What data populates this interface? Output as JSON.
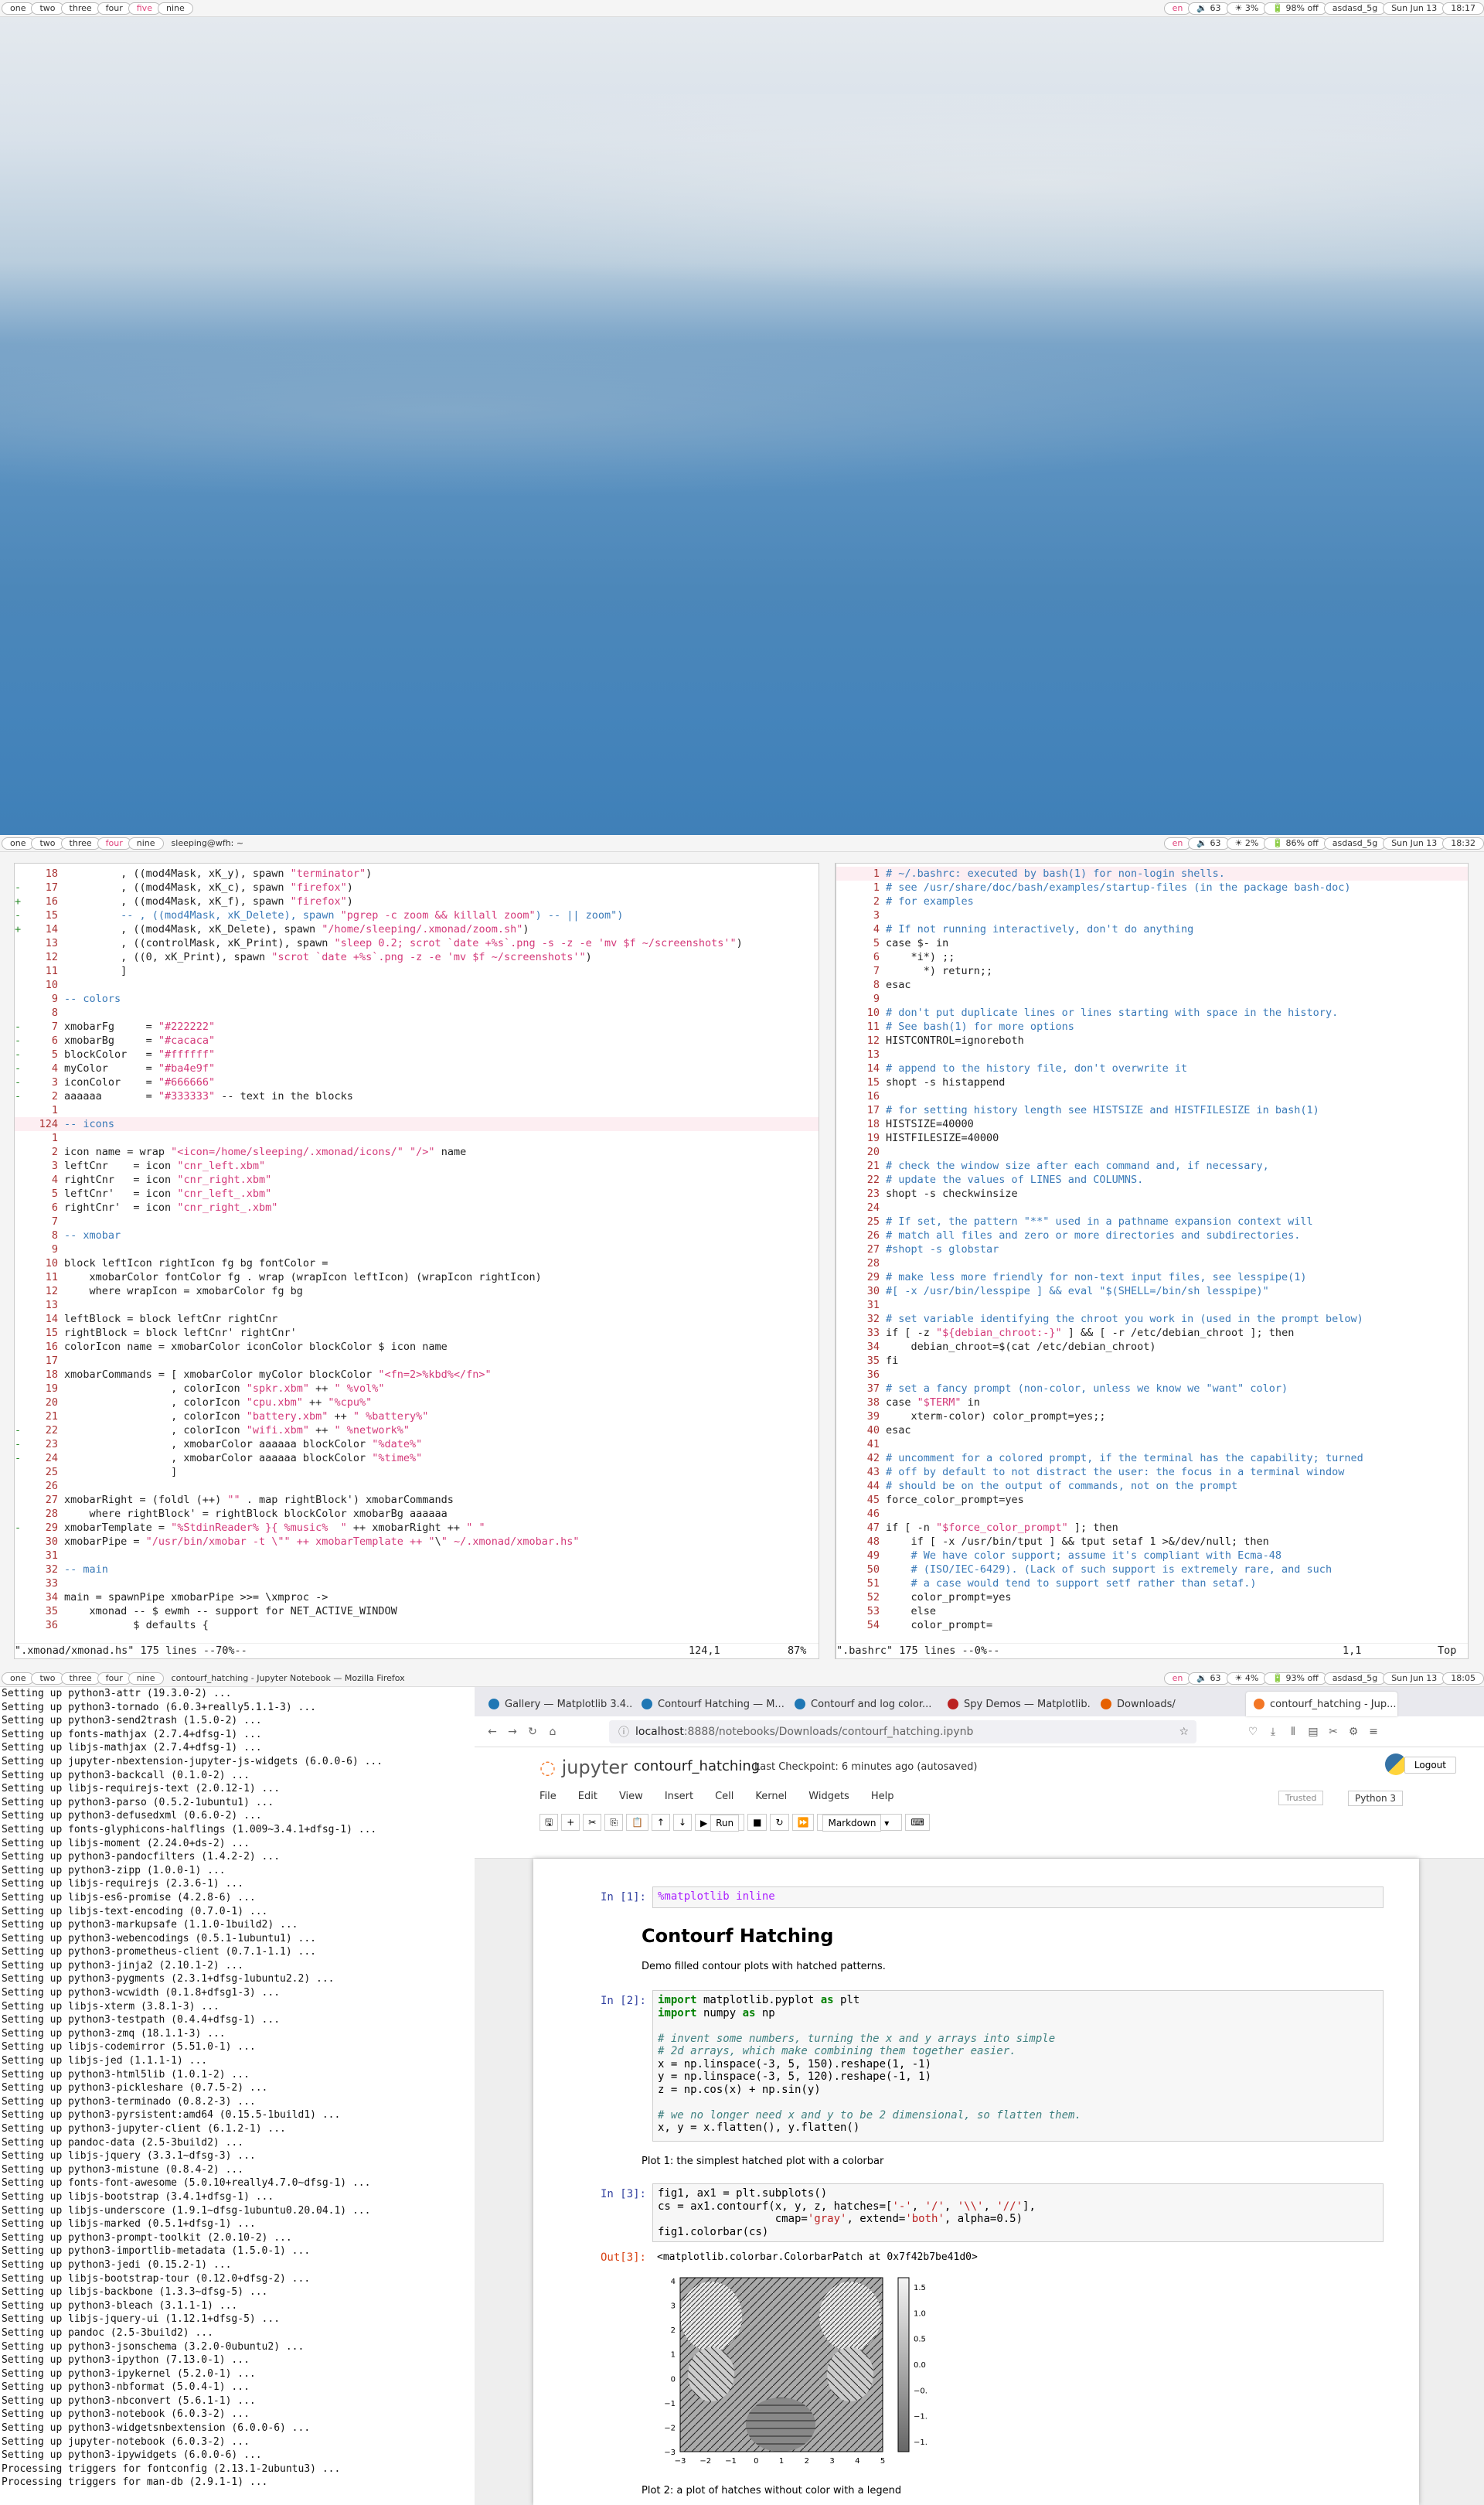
{
  "screen1": {
    "workspaces": [
      "one",
      "two",
      "three",
      "four",
      "five",
      "nine"
    ],
    "active": "five",
    "status": {
      "lang": "en",
      "volume": "🔉 63",
      "brightness": "☀ 3%",
      "battery": "🔋 98% off",
      "wifi": "asdasd_5g",
      "date": "Sun Jun 13",
      "time": "18:17"
    }
  },
  "screen2": {
    "workspaces": [
      "one",
      "two",
      "three",
      "four",
      "nine"
    ],
    "active": "four",
    "title": "sleeping@wfh: ~",
    "status": {
      "lang": "en",
      "volume": "🔉 63",
      "brightness": "☀ 2%",
      "battery": "🔋 86% off",
      "wifi": "asdasd_5g",
      "date": "Sun Jun 13",
      "time": "18:32"
    },
    "left_vim": {
      "lines": [
        [
          "",
          "18",
          "         , ((mod4Mask, xK_y), spawn \"terminator\")"
        ],
        [
          "-",
          "17",
          "         , ((mod4Mask, xK_c), spawn \"firefox\")"
        ],
        [
          "+",
          "16",
          "         , ((mod4Mask, xK_f), spawn \"firefox\")"
        ],
        [
          "-",
          "15",
          "         -- , ((mod4Mask, xK_Delete), spawn \"pgrep -c zoom && killall zoom\") -- || zoom\")"
        ],
        [
          "+",
          "14",
          "         , ((mod4Mask, xK_Delete), spawn \"/home/sleeping/.xmonad/zoom.sh\")"
        ],
        [
          "",
          "13",
          "         , ((controlMask, xK_Print), spawn \"sleep 0.2; scrot `date +%s`.png -s -z -e 'mv $f ~/screenshots'\")"
        ],
        [
          "",
          "12",
          "         , ((0, xK_Print), spawn \"scrot `date +%s`.png -z -e 'mv $f ~/screenshots'\")"
        ],
        [
          "",
          "11",
          "         ]"
        ],
        [
          "",
          "10",
          ""
        ],
        [
          "",
          "9",
          "-- colors"
        ],
        [
          "",
          "8",
          ""
        ],
        [
          "-",
          "7",
          "xmobarFg     = \"#222222\""
        ],
        [
          "-",
          "6",
          "xmobarBg     = \"#cacaca\""
        ],
        [
          "-",
          "5",
          "blockColor   = \"#ffffff\""
        ],
        [
          "-",
          "4",
          "myColor      = \"#ba4e9f\""
        ],
        [
          "-",
          "3",
          "iconColor    = \"#666666\""
        ],
        [
          "-",
          "2",
          "aaaaaa       = \"#333333\" -- text in the blocks"
        ],
        [
          "",
          "1",
          ""
        ],
        [
          "",
          "124",
          "-- icons"
        ],
        [
          "",
          "1",
          ""
        ],
        [
          "",
          "2",
          "icon name = wrap \"<icon=/home/sleeping/.xmonad/icons/\" \"/>\" name"
        ],
        [
          "",
          "3",
          "leftCnr    = icon \"cnr_left.xbm\""
        ],
        [
          "",
          "4",
          "rightCnr   = icon \"cnr_right.xbm\""
        ],
        [
          "",
          "5",
          "leftCnr'   = icon \"cnr_left_.xbm\""
        ],
        [
          "",
          "6",
          "rightCnr'  = icon \"cnr_right_.xbm\""
        ],
        [
          "",
          "7",
          ""
        ],
        [
          "",
          "8",
          "-- xmobar"
        ],
        [
          "",
          "9",
          ""
        ],
        [
          "",
          "10",
          "block leftIcon rightIcon fg bg fontColor ="
        ],
        [
          "",
          "11",
          "    xmobarColor fontColor fg . wrap (wrapIcon leftIcon) (wrapIcon rightIcon)"
        ],
        [
          "",
          "12",
          "    where wrapIcon = xmobarColor fg bg"
        ],
        [
          "",
          "13",
          ""
        ],
        [
          "",
          "14",
          "leftBlock = block leftCnr rightCnr"
        ],
        [
          "",
          "15",
          "rightBlock = block leftCnr' rightCnr'"
        ],
        [
          "",
          "16",
          "colorIcon name = xmobarColor iconColor blockColor $ icon name"
        ],
        [
          "",
          "17",
          ""
        ],
        [
          "",
          "18",
          "xmobarCommands = [ xmobarColor myColor blockColor \"<fn=2>%kbd%</fn>\""
        ],
        [
          "",
          "19",
          "                 , colorIcon \"spkr.xbm\" ++ \" %vol%\""
        ],
        [
          "",
          "20",
          "                 , colorIcon \"cpu.xbm\" ++ \"%cpu%\""
        ],
        [
          "",
          "21",
          "                 , colorIcon \"battery.xbm\" ++ \" %battery%\""
        ],
        [
          "-",
          "22",
          "                 , colorIcon \"wifi.xbm\" ++ \" %network%\""
        ],
        [
          "-",
          "23",
          "                 , xmobarColor aaaaaa blockColor \"%date%\""
        ],
        [
          "-",
          "24",
          "                 , xmobarColor aaaaaa blockColor \"%time%\""
        ],
        [
          "",
          "25",
          "                 ]"
        ],
        [
          "",
          "26",
          ""
        ],
        [
          "",
          "27",
          "xmobarRight = (foldl (++) \"\" . map rightBlock') xmobarCommands"
        ],
        [
          "",
          "28",
          "    where rightBlock' = rightBlock blockColor xmobarBg aaaaaa"
        ],
        [
          "-",
          "29",
          "xmobarTemplate = \"%StdinReader% }{ %music%  \" ++ xmobarRight ++ \" \""
        ],
        [
          "",
          "30",
          "xmobarPipe = \"/usr/bin/xmobar -t \\\"\" ++ xmobarTemplate ++ \"\\\" ~/.xmonad/xmobar.hs\""
        ],
        [
          "",
          "31",
          ""
        ],
        [
          "",
          "32",
          "-- main"
        ],
        [
          "",
          "33",
          ""
        ],
        [
          "",
          "34",
          "main = spawnPipe xmobarPipe >>= \\xmproc ->"
        ],
        [
          "",
          "35",
          "    xmonad -- $ ewmh -- support for NET_ACTIVE_WINDOW"
        ],
        [
          "",
          "36",
          "           $ defaults {"
        ]
      ],
      "status": "\".xmonad/xmonad.hs\" 175 lines --70%--",
      "pos": "124,1",
      "pct": "87%"
    },
    "right_vim": {
      "lines": [
        [
          "",
          "1",
          "# ~/.bashrc: executed by bash(1) for non-login shells."
        ],
        [
          "",
          "1",
          "# see /usr/share/doc/bash/examples/startup-files (in the package bash-doc)"
        ],
        [
          "",
          "2",
          "# for examples"
        ],
        [
          "",
          "3",
          ""
        ],
        [
          "",
          "4",
          "# If not running interactively, don't do anything"
        ],
        [
          "",
          "5",
          "case $- in"
        ],
        [
          "",
          "6",
          "    *i*) ;;"
        ],
        [
          "",
          "7",
          "      *) return;;"
        ],
        [
          "",
          "8",
          "esac"
        ],
        [
          "",
          "9",
          ""
        ],
        [
          "",
          "10",
          "# don't put duplicate lines or lines starting with space in the history."
        ],
        [
          "",
          "11",
          "# See bash(1) for more options"
        ],
        [
          "",
          "12",
          "HISTCONTROL=ignoreboth"
        ],
        [
          "",
          "13",
          ""
        ],
        [
          "",
          "14",
          "# append to the history file, don't overwrite it"
        ],
        [
          "",
          "15",
          "shopt -s histappend"
        ],
        [
          "",
          "16",
          ""
        ],
        [
          "",
          "17",
          "# for setting history length see HISTSIZE and HISTFILESIZE in bash(1)"
        ],
        [
          "",
          "18",
          "HISTSIZE=40000"
        ],
        [
          "",
          "19",
          "HISTFILESIZE=40000"
        ],
        [
          "",
          "20",
          ""
        ],
        [
          "",
          "21",
          "# check the window size after each command and, if necessary,"
        ],
        [
          "",
          "22",
          "# update the values of LINES and COLUMNS."
        ],
        [
          "",
          "23",
          "shopt -s checkwinsize"
        ],
        [
          "",
          "24",
          ""
        ],
        [
          "",
          "25",
          "# If set, the pattern \"**\" used in a pathname expansion context will"
        ],
        [
          "",
          "26",
          "# match all files and zero or more directories and subdirectories."
        ],
        [
          "",
          "27",
          "#shopt -s globstar"
        ],
        [
          "",
          "28",
          ""
        ],
        [
          "",
          "29",
          "# make less more friendly for non-text input files, see lesspipe(1)"
        ],
        [
          "",
          "30",
          "#[ -x /usr/bin/lesspipe ] && eval \"$(SHELL=/bin/sh lesspipe)\""
        ],
        [
          "",
          "31",
          ""
        ],
        [
          "",
          "32",
          "# set variable identifying the chroot you work in (used in the prompt below)"
        ],
        [
          "",
          "33",
          "if [ -z \"${debian_chroot:-}\" ] && [ -r /etc/debian_chroot ]; then"
        ],
        [
          "",
          "34",
          "    debian_chroot=$(cat /etc/debian_chroot)"
        ],
        [
          "",
          "35",
          "fi"
        ],
        [
          "",
          "36",
          ""
        ],
        [
          "",
          "37",
          "# set a fancy prompt (non-color, unless we know we \"want\" color)"
        ],
        [
          "",
          "38",
          "case \"$TERM\" in"
        ],
        [
          "",
          "39",
          "    xterm-color) color_prompt=yes;;"
        ],
        [
          "",
          "40",
          "esac"
        ],
        [
          "",
          "41",
          ""
        ],
        [
          "",
          "42",
          "# uncomment for a colored prompt, if the terminal has the capability; turned"
        ],
        [
          "",
          "43",
          "# off by default to not distract the user: the focus in a terminal window"
        ],
        [
          "",
          "44",
          "# should be on the output of commands, not on the prompt"
        ],
        [
          "",
          "45",
          "force_color_prompt=yes"
        ],
        [
          "",
          "46",
          ""
        ],
        [
          "",
          "47",
          "if [ -n \"$force_color_prompt\" ]; then"
        ],
        [
          "",
          "48",
          "    if [ -x /usr/bin/tput ] && tput setaf 1 >&/dev/null; then"
        ],
        [
          "",
          "49",
          "    # We have color support; assume it's compliant with Ecma-48"
        ],
        [
          "",
          "50",
          "    # (ISO/IEC-6429). (Lack of such support is extremely rare, and such"
        ],
        [
          "",
          "51",
          "    # a case would tend to support setf rather than setaf.)"
        ],
        [
          "",
          "52",
          "    color_prompt=yes"
        ],
        [
          "",
          "53",
          "    else"
        ],
        [
          "",
          "54",
          "    color_prompt="
        ]
      ],
      "status": "\".bashrc\" 175 lines --0%--",
      "pos": "1,1",
      "pct": "Top"
    }
  },
  "screen3": {
    "workspaces": [
      "one",
      "two",
      "three",
      "four",
      "nine"
    ],
    "active": "",
    "title": "contourf_hatching - Jupyter Notebook — Mozilla Firefox",
    "status": {
      "lang": "en",
      "volume": "🔉 63",
      "brightness": "☀ 4%",
      "battery": "🔋 93% off",
      "wifi": "asdasd_5g",
      "date": "Sun Jun 13",
      "time": "18:05"
    },
    "terminal": [
      "Setting up python3-attr (19.3.0-2) ...",
      "Setting up python3-tornado (6.0.3+really5.1.1-3) ...",
      "Setting up python3-send2trash (1.5.0-2) ...",
      "Setting up fonts-mathjax (2.7.4+dfsg-1) ...",
      "Setting up libjs-mathjax (2.7.4+dfsg-1) ...",
      "Setting up jupyter-nbextension-jupyter-js-widgets (6.0.0-6) ...",
      "Setting up python3-backcall (0.1.0-2) ...",
      "Setting up libjs-requirejs-text (2.0.12-1) ...",
      "Setting up python3-parso (0.5.2-1ubuntu1) ...",
      "Setting up python3-defusedxml (0.6.0-2) ...",
      "Setting up fonts-glyphicons-halflings (1.009~3.4.1+dfsg-1) ...",
      "Setting up libjs-moment (2.24.0+ds-2) ...",
      "Setting up python3-pandocfilters (1.4.2-2) ...",
      "Setting up python3-zipp (1.0.0-1) ...",
      "Setting up libjs-requirejs (2.3.6-1) ...",
      "Setting up libjs-es6-promise (4.2.8-6) ...",
      "Setting up libjs-text-encoding (0.7.0-1) ...",
      "Setting up python3-markupsafe (1.1.0-1build2) ...",
      "Setting up python3-webencodings (0.5.1-1ubuntu1) ...",
      "Setting up python3-prometheus-client (0.7.1-1.1) ...",
      "Setting up python3-jinja2 (2.10.1-2) ...",
      "Setting up python3-pygments (2.3.1+dfsg-1ubuntu2.2) ...",
      "Setting up python3-wcwidth (0.1.8+dfsg1-3) ...",
      "Setting up libjs-xterm (3.8.1-3) ...",
      "Setting up python3-testpath (0.4.4+dfsg-1) ...",
      "Setting up python3-zmq (18.1.1-3) ...",
      "Setting up libjs-codemirror (5.51.0-1) ...",
      "Setting up libjs-jed (1.1.1-1) ...",
      "Setting up python3-html5lib (1.0.1-2) ...",
      "Setting up python3-pickleshare (0.7.5-2) ...",
      "Setting up python3-terminado (0.8.2-3) ...",
      "Setting up python3-pyrsistent:amd64 (0.15.5-1build1) ...",
      "Setting up python3-jupyter-client (6.1.2-1) ...",
      "Setting up pandoc-data (2.5-3build2) ...",
      "Setting up libjs-jquery (3.3.1~dfsg-3) ...",
      "Setting up python3-mistune (0.8.4-2) ...",
      "Setting up fonts-font-awesome (5.0.10+really4.7.0~dfsg-1) ...",
      "Setting up libjs-bootstrap (3.4.1+dfsg-1) ...",
      "Setting up libjs-underscore (1.9.1~dfsg-1ubuntu0.20.04.1) ...",
      "Setting up libjs-marked (0.5.1+dfsg-1) ...",
      "Setting up python3-prompt-toolkit (2.0.10-2) ...",
      "Setting up python3-importlib-metadata (1.5.0-1) ...",
      "Setting up python3-jedi (0.15.2-1) ...",
      "Setting up libjs-bootstrap-tour (0.12.0+dfsg-2) ...",
      "Setting up libjs-backbone (1.3.3~dfsg-5) ...",
      "Setting up python3-bleach (3.1.1-1) ...",
      "Setting up libjs-jquery-ui (1.12.1+dfsg-5) ...",
      "Setting up pandoc (2.5-3build2) ...",
      "Setting up python3-jsonschema (3.2.0-0ubuntu2) ...",
      "Setting up python3-ipython (7.13.0-1) ...",
      "Setting up python3-ipykernel (5.2.0-1) ...",
      "Setting up python3-nbformat (5.0.4-1) ...",
      "Setting up python3-nbconvert (5.6.1-1) ...",
      "Setting up python3-notebook (6.0.3-2) ...",
      "Setting up python3-widgetsnbextension (6.0.0-6) ...",
      "Setting up jupyter-notebook (6.0.3-2) ...",
      "Setting up python3-ipywidgets (6.0.0-6) ...",
      "Processing triggers for fontconfig (2.13.1-2ubuntu3) ...",
      "Processing triggers for man-db (2.9.1-1) ..."
    ],
    "browser": {
      "tabs": [
        "Gallery — Matplotlib 3.4...",
        "Contourf Hatching — M...",
        "Contourf and log color...",
        "Spy Demos — Matplotlib...",
        "Downloads/",
        "contourf_hatching - Jup..."
      ],
      "url_host": "localhost",
      "url_path": ":8888/notebooks/Downloads/contourf_hatching.ipynb",
      "logo": "jupyter",
      "nbname": "contourf_hatching",
      "checkpoint": "Last Checkpoint: 6 minutes ago  (autosaved)",
      "logout": "Logout",
      "menu": [
        "File",
        "Edit",
        "View",
        "Insert",
        "Cell",
        "Kernel",
        "Widgets",
        "Help"
      ],
      "trusted": "Trusted",
      "kernel": "Python 3",
      "cell_type": "Markdown",
      "run": "Run",
      "cell1_prompt": "In [1]:",
      "cell1_code": "%matplotlib inline",
      "heading": "Contourf Hatching",
      "desc": "Demo filled contour plots with hatched patterns.",
      "cell2_prompt": "In [2]:",
      "cell2_code": [
        "import matplotlib.pyplot as plt",
        "import numpy as np",
        "",
        "# invent some numbers, turning the x and y arrays into simple",
        "# 2d arrays, which make combining them together easier.",
        "x = np.linspace(-3, 5, 150).reshape(1, -1)",
        "y = np.linspace(-3, 5, 120).reshape(-1, 1)",
        "z = np.cos(x) + np.sin(y)",
        "",
        "# we no longer need x and y to be 2 dimensional, so flatten them.",
        "x, y = x.flatten(), y.flatten()"
      ],
      "plot1_label": "Plot 1: the simplest hatched plot with a colorbar",
      "cell3_prompt": "In [3]:",
      "cell3_code": [
        "fig1, ax1 = plt.subplots()",
        "cs = ax1.contourf(x, y, z, hatches=['-', '/', '\\\\', '//'],",
        "                  cmap='gray', extend='both', alpha=0.5)",
        "fig1.colorbar(cs)"
      ],
      "out3_prompt": "Out[3]:",
      "out3": "<matplotlib.colorbar.ColorbarPatch at 0x7f42b7be41d0>",
      "yticks": [
        "4",
        "3",
        "2",
        "1",
        "0",
        "−1",
        "−2",
        "−3"
      ],
      "xticks": [
        "−3",
        "−2",
        "−1",
        "0",
        "1",
        "2",
        "3",
        "4",
        "5"
      ],
      "cbticks": [
        "1.5",
        "1.0",
        "0.5",
        "0.0",
        "−0.5",
        "−1.0",
        "−1.5"
      ],
      "plot2_label": "Plot 2: a plot of hatches without color with a legend"
    }
  }
}
